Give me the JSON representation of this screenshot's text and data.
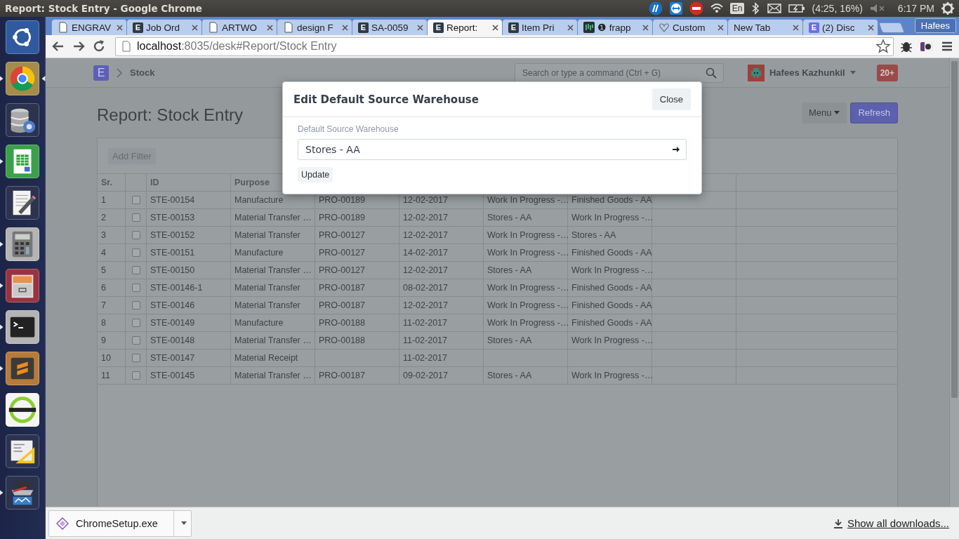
{
  "top_panel": {
    "title": "Report: Stock Entry - Google Chrome",
    "indicators": [
      {
        "kind": "hp"
      },
      {
        "kind": "remote"
      },
      {
        "kind": "stop"
      },
      {
        "kind": "wifi"
      },
      {
        "kind": "keyboard",
        "label": "En"
      },
      {
        "kind": "bluetooth"
      },
      {
        "kind": "mail"
      },
      {
        "kind": "battery",
        "label": "(4:25, 16%)"
      },
      {
        "kind": "volume"
      },
      {
        "kind": "clock",
        "label": "6:17 PM"
      },
      {
        "kind": "power"
      }
    ]
  },
  "launcher": [
    {
      "kind": "ubuntu",
      "running": false,
      "focused": false
    },
    {
      "kind": "browser",
      "running": true,
      "focused": true
    },
    {
      "kind": "database",
      "running": false,
      "focused": false
    },
    {
      "kind": "spreadsheet",
      "running": true,
      "focused": false
    },
    {
      "kind": "editor",
      "running": false,
      "focused": false
    },
    {
      "kind": "calculator",
      "running": true,
      "focused": false
    },
    {
      "kind": "cabinet",
      "running": true,
      "focused": false
    },
    {
      "kind": "terminal",
      "running": true,
      "focused": false
    },
    {
      "kind": "sublime",
      "running": true,
      "focused": false
    },
    {
      "kind": "ring",
      "running": false,
      "focused": false
    },
    {
      "kind": "drafting",
      "running": false,
      "focused": false
    },
    {
      "kind": "stack",
      "running": true,
      "focused": false
    }
  ],
  "browser": {
    "tabs": [
      {
        "title": "ENGRAV",
        "favicon": {
          "kind": "page"
        },
        "selected": false
      },
      {
        "title": "Job Ord",
        "favicon": {
          "kind": "letter",
          "text": "E",
          "color": "#2f3a45"
        },
        "selected": false
      },
      {
        "title": "ARTWO",
        "favicon": {
          "kind": "page"
        },
        "selected": false
      },
      {
        "title": "design F",
        "favicon": {
          "kind": "page"
        },
        "selected": false
      },
      {
        "title": "SA-0059",
        "favicon": {
          "kind": "letter",
          "text": "E",
          "color": "#2f3a45"
        },
        "selected": false
      },
      {
        "title": "Report:",
        "favicon": {
          "kind": "letter",
          "text": "E",
          "color": "#2f3a45"
        },
        "selected": true
      },
      {
        "title": "Item Pri",
        "favicon": {
          "kind": "letter",
          "text": "E",
          "color": "#2f3a45"
        },
        "selected": false
      },
      {
        "title": "❶ frapp",
        "favicon": {
          "kind": "bars"
        },
        "selected": false
      },
      {
        "title": "Custom",
        "favicon": {
          "kind": "heart"
        },
        "selected": false
      },
      {
        "title": "New Tab",
        "favicon": {
          "kind": "none"
        },
        "selected": false
      },
      {
        "title": "(2) Disc",
        "favicon": {
          "kind": "letter",
          "text": "E",
          "color": "#6d6fe0"
        },
        "selected": false
      }
    ],
    "profile": "Hafees",
    "address": {
      "host": "localhost",
      "path": ":8035/desk#Report/Stock Entry"
    }
  },
  "app": {
    "navbar": {
      "logo": "E",
      "breadcrumb": "Stock",
      "search": {
        "placeholder": "Search or type a command (Ctrl + G)"
      },
      "user": "Hafees Kazhunkil",
      "notifications": "20+"
    },
    "page_title": "Report: Stock Entry",
    "buttons": [
      {
        "label": "Menu",
        "kind": "dropdown"
      },
      {
        "label": "Refresh",
        "kind": "primary"
      }
    ],
    "add_filter": "Add Filter",
    "table": {
      "columns": [
        "Sr.",
        "",
        "ID",
        "Purpose"
      ],
      "rows": [
        {
          "checked": false,
          "cells": [
            "1",
            "",
            "STE-00154",
            "Manufacture",
            "PRO-00189",
            "12-02-2017",
            "Work In Progress -…",
            "Finished Goods - AA"
          ]
        },
        {
          "checked": false,
          "cells": [
            "2",
            "",
            "STE-00153",
            "Material Transfer …",
            "PRO-00189",
            "12-02-2017",
            "Stores - AA",
            "Work In Progress -…"
          ]
        },
        {
          "checked": false,
          "cells": [
            "3",
            "",
            "STE-00152",
            "Material Transfer",
            "PRO-00127",
            "12-02-2017",
            "Work In Progress -…",
            "Stores - AA"
          ]
        },
        {
          "checked": false,
          "cells": [
            "4",
            "",
            "STE-00151",
            "Manufacture",
            "PRO-00127",
            "14-02-2017",
            "Work In Progress -…",
            "Finished Goods - AA"
          ]
        },
        {
          "checked": false,
          "cells": [
            "5",
            "",
            "STE-00150",
            "Material Transfer …",
            "PRO-00127",
            "12-02-2017",
            "Stores - AA",
            "Work In Progress -…"
          ]
        },
        {
          "checked": false,
          "cells": [
            "6",
            "",
            "STE-00146-1",
            "Material Transfer",
            "PRO-00187",
            "08-02-2017",
            "Work In Progress -…",
            "Finished Goods - AA"
          ]
        },
        {
          "checked": false,
          "cells": [
            "7",
            "",
            "STE-00146",
            "Material Transfer",
            "PRO-00187",
            "12-02-2017",
            "Work In Progress -…",
            "Finished Goods - AA"
          ]
        },
        {
          "checked": false,
          "cells": [
            "8",
            "",
            "STE-00149",
            "Manufacture",
            "PRO-00188",
            "11-02-2017",
            "Work In Progress -…",
            "Finished Goods - AA"
          ]
        },
        {
          "checked": false,
          "cells": [
            "9",
            "",
            "STE-00148",
            "Material Transfer …",
            "PRO-00188",
            "11-02-2017",
            "Stores - AA",
            "Work In Progress -…"
          ]
        },
        {
          "checked": false,
          "cells": [
            "10",
            "",
            "STE-00147",
            "Material Receipt",
            null,
            "11-02-2017",
            null,
            null
          ]
        },
        {
          "checked": false,
          "cells": [
            "11",
            "",
            "STE-00145",
            "Material Transfer …",
            "PRO-00187",
            "09-02-2017",
            "Stores - AA",
            "Work In Progress -…"
          ]
        }
      ]
    }
  },
  "dialog": {
    "title": "Edit Default Source Warehouse",
    "close": "Close",
    "field": {
      "label": "Default Source Warehouse",
      "value": "Stores - AA"
    },
    "update": "Update"
  },
  "downloads": {
    "file": "ChromeSetup.exe",
    "show_all": "Show all downloads..."
  }
}
